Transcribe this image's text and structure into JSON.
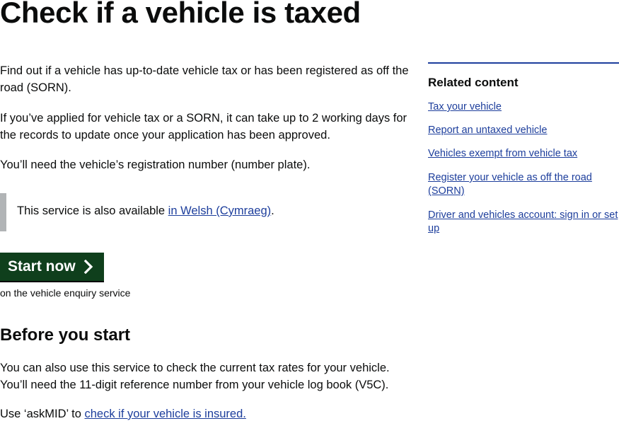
{
  "page": {
    "title": "Check if a vehicle is taxed"
  },
  "main": {
    "intro": "Find out if a vehicle has up-to-date vehicle tax or has been registered as off the road (SORN).",
    "sorn_note": "If you’ve applied for vehicle tax or a SORN, it can take up to 2 working days for the records to update once your application has been approved.",
    "reg_note": "You’ll need the vehicle’s registration number (number plate).",
    "inset": {
      "text_before": "This service is also available ",
      "link": "in Welsh (Cymraeg)",
      "text_after": "."
    },
    "start_button": {
      "label": "Start now",
      "icon": "chevron-right-icon"
    },
    "start_sub": "on the vehicle enquiry service",
    "before_heading": "Before you start",
    "rates_note": "You can also use this service to check the current tax rates for your vehicle. You’ll need the 11-digit reference number from your vehicle log book (V5C).",
    "askmid": {
      "text_before": "Use ‘askMID’ to ",
      "link": "check if your vehicle is insured."
    }
  },
  "aside": {
    "title": "Related content",
    "links": [
      "Tax your vehicle",
      "Report an untaxed vehicle",
      "Vehicles exempt from vehicle tax",
      "Register your vehicle as off the road (SORN)",
      "Driver and vehicles account: sign in or set up"
    ]
  },
  "colors": {
    "text": "#0b0c0c",
    "link": "#1d3e9c",
    "start_button": "#0f3f1c",
    "inset_border": "#b1b4b6"
  }
}
